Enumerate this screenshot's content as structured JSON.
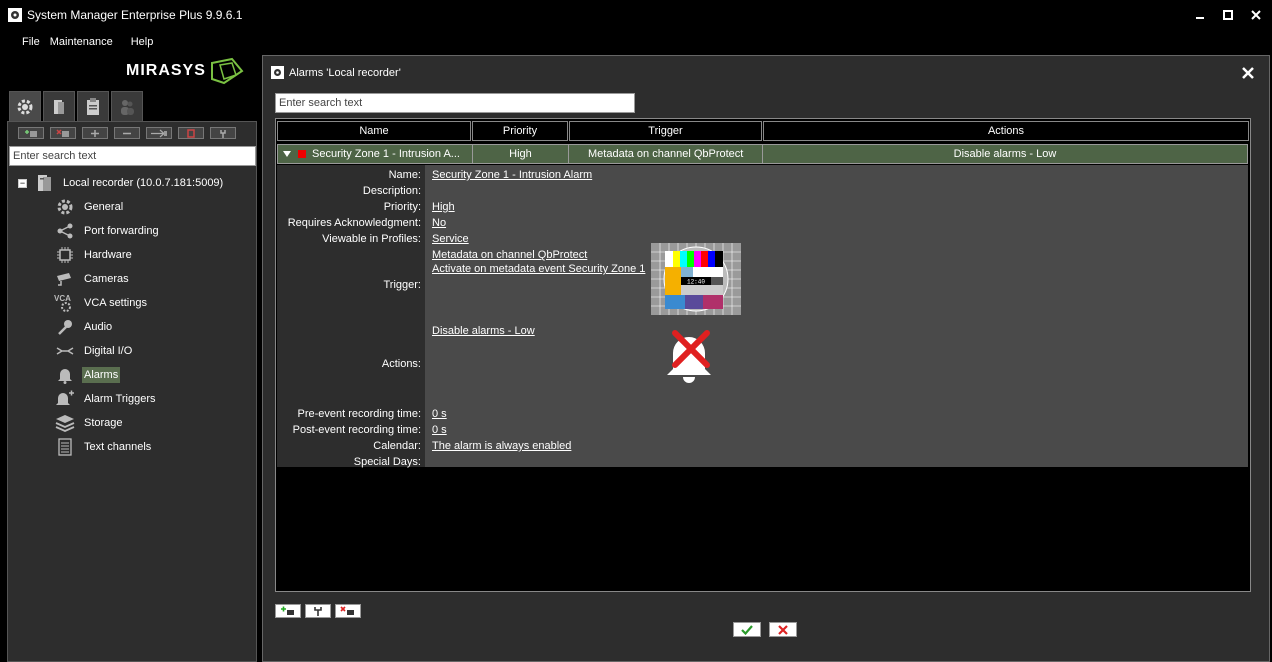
{
  "window": {
    "title": "System Manager Enterprise Plus 9.9.6.1"
  },
  "menu": {
    "items": [
      "File",
      "Maintenance",
      "Help"
    ]
  },
  "brand": {
    "name": "MIRASYS"
  },
  "left": {
    "search_placeholder": "Enter search text",
    "root": {
      "label": "Local recorder (10.0.7.181:5009)"
    },
    "items": [
      {
        "label": "General",
        "icon": "gear-icon"
      },
      {
        "label": "Port forwarding",
        "icon": "share-icon"
      },
      {
        "label": "Hardware",
        "icon": "chip-icon"
      },
      {
        "label": "Cameras",
        "icon": "camera-icon"
      },
      {
        "label": "VCA settings",
        "icon": "vca-icon"
      },
      {
        "label": "Audio",
        "icon": "microphone-icon"
      },
      {
        "label": "Digital I/O",
        "icon": "io-icon"
      },
      {
        "label": "Alarms",
        "icon": "bell-icon",
        "selected": true
      },
      {
        "label": "Alarm Triggers",
        "icon": "bell-plus-icon"
      },
      {
        "label": "Storage",
        "icon": "layers-icon"
      },
      {
        "label": "Text channels",
        "icon": "document-icon"
      }
    ]
  },
  "dialog": {
    "title": "Alarms 'Local recorder'",
    "search_placeholder": "Enter search text",
    "columns": [
      "Name",
      "Priority",
      "Trigger",
      "Actions"
    ],
    "row": {
      "name": "Security Zone 1 - Intrusion A...",
      "priority": "High",
      "trigger": "Metadata on channel QbProtect",
      "actions": "Disable alarms - Low"
    },
    "details": {
      "labels": {
        "name": "Name:",
        "description": "Description:",
        "priority": "Priority:",
        "ack": "Requires Acknowledgment:",
        "profiles": "Viewable in Profiles:",
        "trigger": "Trigger:",
        "actions": "Actions:",
        "pre": "Pre-event recording time:",
        "post": "Post-event recording time:",
        "calendar": "Calendar:",
        "special": "Special Days:"
      },
      "values": {
        "name": "Security Zone 1 - Intrusion Alarm",
        "priority": "High",
        "ack": "No",
        "profiles": "Service",
        "trigger1": "Metadata on channel QbProtect",
        "trigger2": "Activate on metadata event Security Zone 1",
        "actions": "Disable alarms - Low",
        "pre": "0 s",
        "post": "0 s",
        "calendar": "The alarm is always enabled"
      },
      "test_pattern_text": "12:40"
    }
  },
  "colors": {
    "selected_row": "#4e6446",
    "selected_item": "#5a6e4f",
    "brand_green": "#7ac142"
  }
}
